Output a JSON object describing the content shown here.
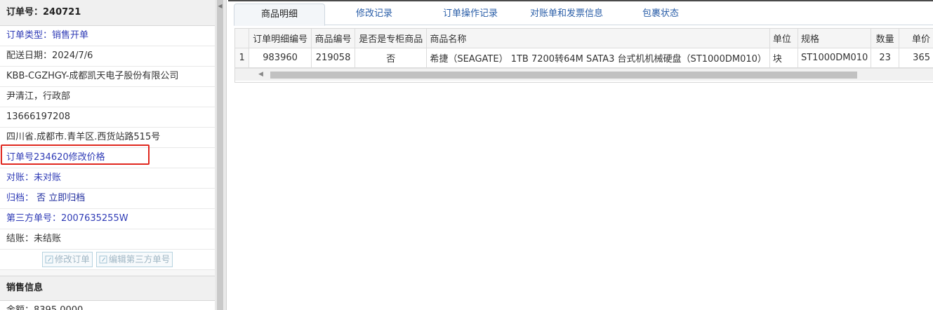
{
  "left_panel": {
    "order_title": "订单号：240721",
    "rows": {
      "order_type": "订单类型：销售开单",
      "delivery_date": "配送日期：2024/7/6",
      "company": "KBB-CGZHGY-成都凯天电子股份有限公司",
      "contact": "尹清江，行政部",
      "phone": "13666197208",
      "address": "四川省.成都市.青羊区.西货站路515号",
      "note": "订单号234620修改价格",
      "reconcile_label": "对账：",
      "reconcile_value": "未对账",
      "archive_label": "归档：",
      "archive_value": "否 立即归档",
      "third_party": "第三方单号：2007635255W",
      "settlement": "结账：未结账"
    },
    "buttons": {
      "edit_order": "修改订单",
      "edit_third_party": "编辑第三方单号"
    },
    "sales_section_title": "销售信息",
    "amount": "金额：8395.0000"
  },
  "tabs": [
    {
      "label": "商品明细",
      "active": true
    },
    {
      "label": "修改记录",
      "active": false
    },
    {
      "label": "订单操作记录",
      "active": false
    },
    {
      "label": "对账单和发票信息",
      "active": false
    },
    {
      "label": "包裹状态",
      "active": false
    }
  ],
  "grid": {
    "headers": [
      "",
      "订单明细编号",
      "商品编号",
      "是否是专柜商品",
      "商品名称",
      "单位",
      "规格",
      "数量",
      "单价"
    ],
    "rows": [
      {
        "row_num": "1",
        "detail_id": "983960",
        "product_id": "219058",
        "is_counter": "否",
        "product_name": "希捷（SEAGATE） 1TB 7200转64M SATA3 台式机机械硬盘（ST1000DM010）",
        "unit": "块",
        "spec": "ST1000DM010",
        "qty": "23",
        "price": "365"
      }
    ]
  },
  "colors": {
    "link_blue": "#2736b3",
    "highlight_red": "#e0281f",
    "tab_text": "#2a5ea8"
  }
}
